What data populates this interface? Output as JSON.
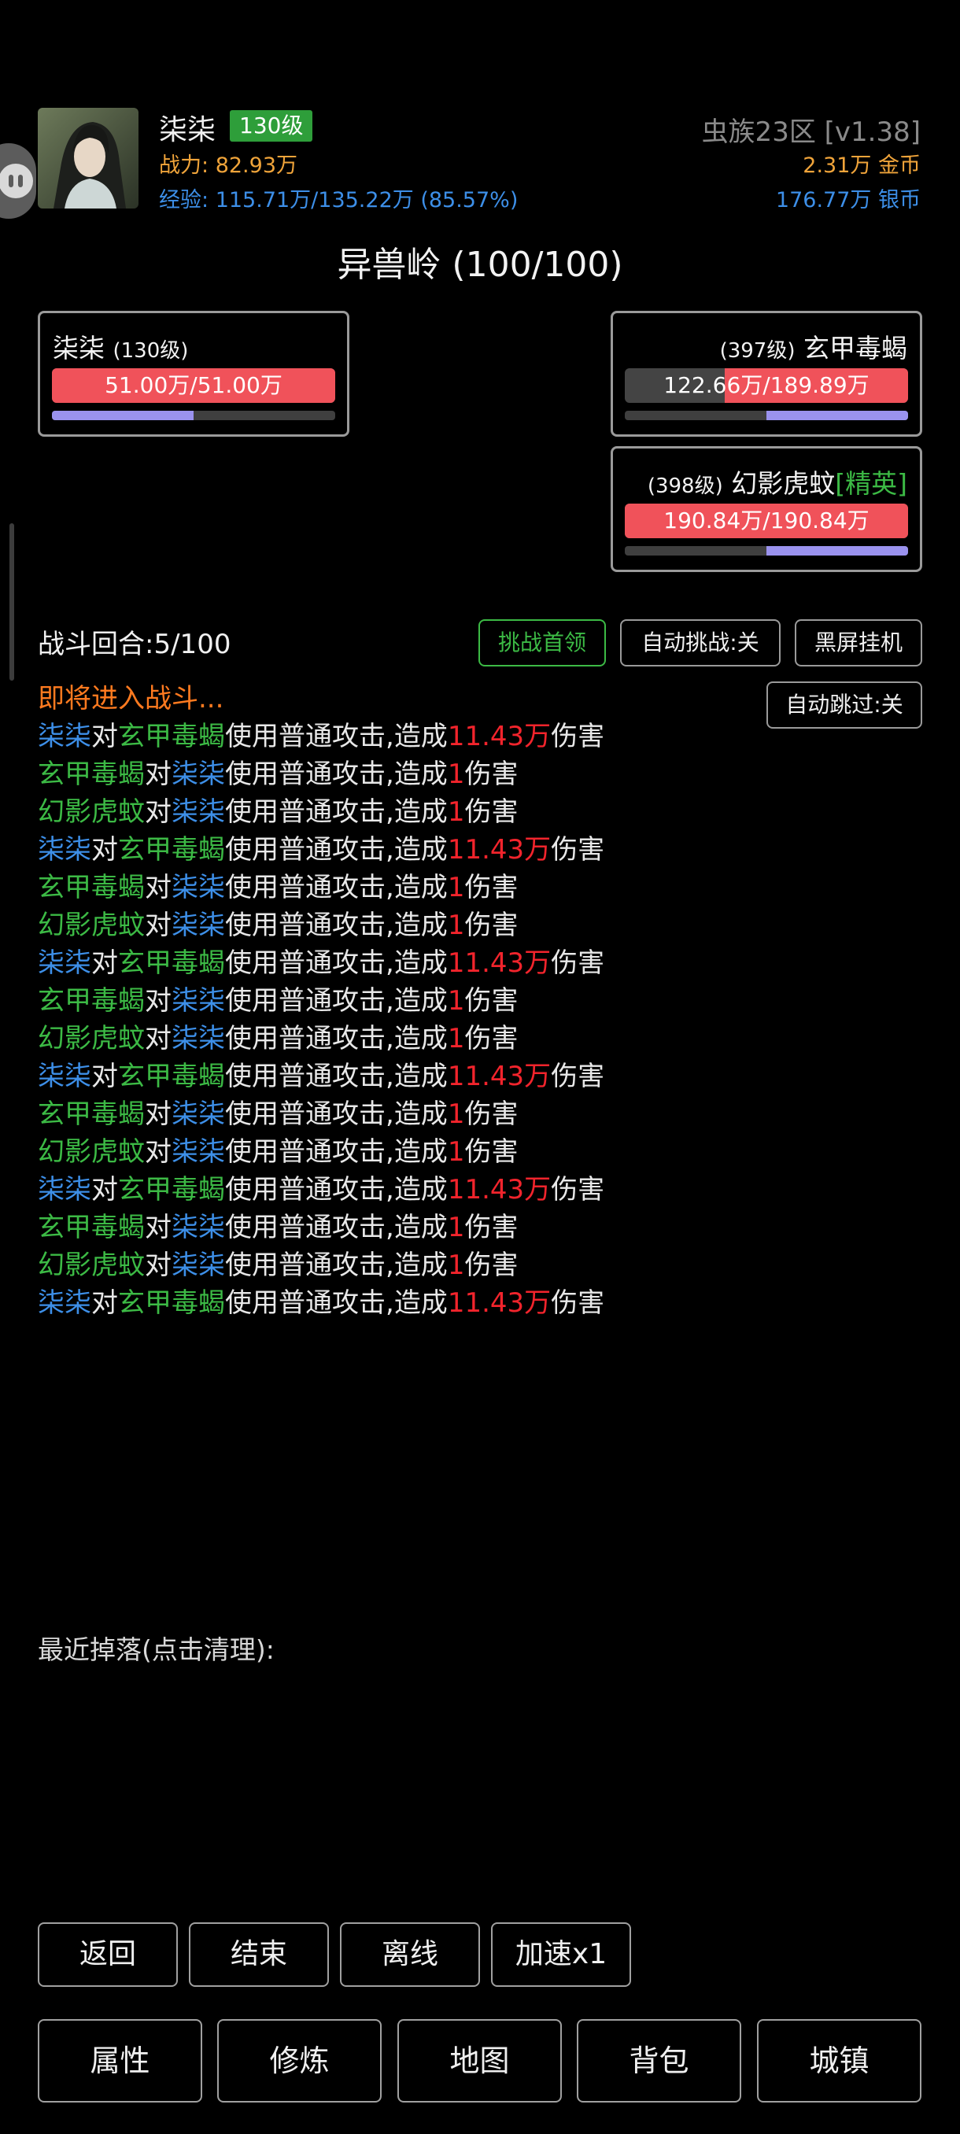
{
  "player": {
    "name": "柒柒",
    "level_badge": "130级",
    "power_label": "战力:",
    "power_value": "82.93万",
    "exp_label": "经验:",
    "exp_value": "115.71万/135.22万 (85.57%)"
  },
  "server": {
    "name": "虫族23区 [v1.38]",
    "gold_value": "2.31万",
    "gold_label": "金币",
    "silver_value": "176.77万",
    "silver_label": "银币"
  },
  "map_title": "异兽岭 (100/100)",
  "units": {
    "player": {
      "name": "柒柒",
      "level": "(130级)",
      "hp_text": "51.00万/51.00万",
      "hp_ratio": 1.0,
      "mp_ratio": 0.5
    },
    "enemy1": {
      "name": "玄甲毒蝎",
      "level": "(397级)",
      "hp_text": "122.66万/189.89万",
      "hp_ratio": 0.646,
      "mp_ratio": 0.5
    },
    "enemy2": {
      "name": "幻影虎蚊",
      "level": "(398级)",
      "elite_tag": "[精英]",
      "hp_text": "190.84万/190.84万",
      "hp_ratio": 1.0,
      "mp_ratio": 0.5
    }
  },
  "battle": {
    "round_label": "战斗回合:",
    "round_value": "5/100",
    "challenge_boss_label": "挑战首领",
    "auto_challenge_label": "自动挑战:关",
    "black_screen_label": "黑屏挂机",
    "auto_skip_label": "自动跳过:关",
    "entering_text": "即将进入战斗..."
  },
  "log": [
    {
      "a": "柒柒",
      "a_color": "blue",
      "b": "玄甲毒蝎",
      "b_color": "green",
      "dmg": "11.43万"
    },
    {
      "a": "玄甲毒蝎",
      "a_color": "green",
      "b": "柒柒",
      "b_color": "blue",
      "dmg": "1"
    },
    {
      "a": "幻影虎蚊",
      "a_color": "green",
      "b": "柒柒",
      "b_color": "blue",
      "dmg": "1"
    },
    {
      "a": "柒柒",
      "a_color": "blue",
      "b": "玄甲毒蝎",
      "b_color": "green",
      "dmg": "11.43万"
    },
    {
      "a": "玄甲毒蝎",
      "a_color": "green",
      "b": "柒柒",
      "b_color": "blue",
      "dmg": "1"
    },
    {
      "a": "幻影虎蚊",
      "a_color": "green",
      "b": "柒柒",
      "b_color": "blue",
      "dmg": "1"
    },
    {
      "a": "柒柒",
      "a_color": "blue",
      "b": "玄甲毒蝎",
      "b_color": "green",
      "dmg": "11.43万"
    },
    {
      "a": "玄甲毒蝎",
      "a_color": "green",
      "b": "柒柒",
      "b_color": "blue",
      "dmg": "1"
    },
    {
      "a": "幻影虎蚊",
      "a_color": "green",
      "b": "柒柒",
      "b_color": "blue",
      "dmg": "1"
    },
    {
      "a": "柒柒",
      "a_color": "blue",
      "b": "玄甲毒蝎",
      "b_color": "green",
      "dmg": "11.43万"
    },
    {
      "a": "玄甲毒蝎",
      "a_color": "green",
      "b": "柒柒",
      "b_color": "blue",
      "dmg": "1"
    },
    {
      "a": "幻影虎蚊",
      "a_color": "green",
      "b": "柒柒",
      "b_color": "blue",
      "dmg": "1"
    },
    {
      "a": "柒柒",
      "a_color": "blue",
      "b": "玄甲毒蝎",
      "b_color": "green",
      "dmg": "11.43万"
    },
    {
      "a": "玄甲毒蝎",
      "a_color": "green",
      "b": "柒柒",
      "b_color": "blue",
      "dmg": "1"
    },
    {
      "a": "幻影虎蚊",
      "a_color": "green",
      "b": "柒柒",
      "b_color": "blue",
      "dmg": "1"
    },
    {
      "a": "柒柒",
      "a_color": "blue",
      "b": "玄甲毒蝎",
      "b_color": "green",
      "dmg": "11.43万"
    }
  ],
  "log_text": {
    "to": "对",
    "action": "使用普通攻击,",
    "deal": "造成",
    "damage": "伤害"
  },
  "drops_label": "最近掉落(点击清理):",
  "controls": {
    "back": "返回",
    "end": "结束",
    "offline": "离线",
    "speed": "加速x1"
  },
  "nav": {
    "attributes": "属性",
    "cultivate": "修炼",
    "map": "地图",
    "bag": "背包",
    "town": "城镇"
  },
  "colors": {
    "blue": "#3d8fe8",
    "green": "#3cba45",
    "red": "#f2242c",
    "orange": "#ff7a1f",
    "gold": "#f0a43a",
    "hp": "#f0525a",
    "mp": "#9a92ee"
  }
}
